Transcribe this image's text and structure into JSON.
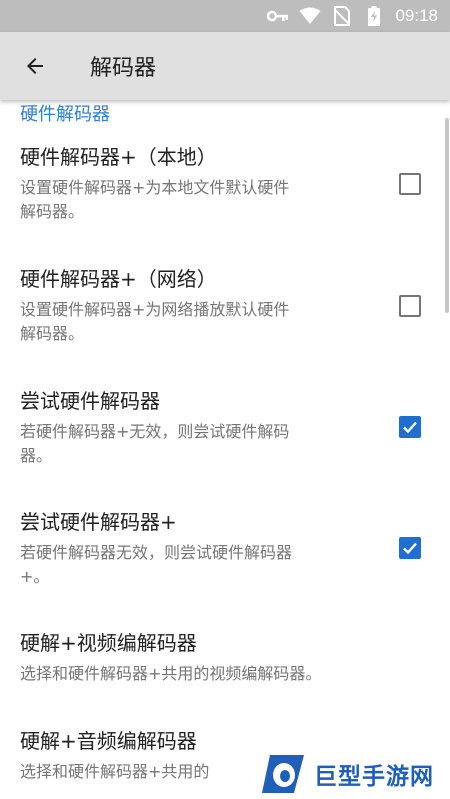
{
  "status_bar": {
    "time": "09:18",
    "icons": [
      "vpn-key-icon",
      "wifi-icon",
      "no-sim-icon",
      "battery-charging-icon"
    ]
  },
  "app_bar": {
    "title": "解码器",
    "back_icon": "arrow-back-icon"
  },
  "section": {
    "header": "硬件解码器"
  },
  "preferences": [
    {
      "title": "硬件解码器+（本地）",
      "summary_lines": [
        "设置硬件解码器+为本地文件默认硬件",
        "解码器。"
      ],
      "checked": false
    },
    {
      "title": "硬件解码器+（网络）",
      "summary_lines": [
        "设置硬件解码器+为网络播放默认硬件",
        "解码器。"
      ],
      "checked": false
    },
    {
      "title": "尝试硬件解码器",
      "summary_lines": [
        "若硬件解码器+无效，则尝试硬件解码",
        "器。"
      ],
      "checked": true
    },
    {
      "title": "尝试硬件解码器+",
      "summary_lines": [
        "若硬件解码器无效，则尝试硬件解码器",
        "+。"
      ],
      "checked": true
    },
    {
      "title": "硬解+视频编解码器",
      "summary_lines": [
        "选择和硬件解码器+共用的视频编解码器。"
      ]
    },
    {
      "title": "硬解+音频编解码器",
      "summary_lines": [
        "选择和硬件解码器+共用的"
      ]
    }
  ],
  "watermark": {
    "text": "巨型手游网",
    "logo_icon": "brand-logo-icon"
  },
  "colors": {
    "accent": "#1e6fcf",
    "section_header": "#2f7fd6",
    "status_bar": "#bdbdbd",
    "app_bar": "#e0e0e0",
    "watermark": "#1f5fb8"
  }
}
